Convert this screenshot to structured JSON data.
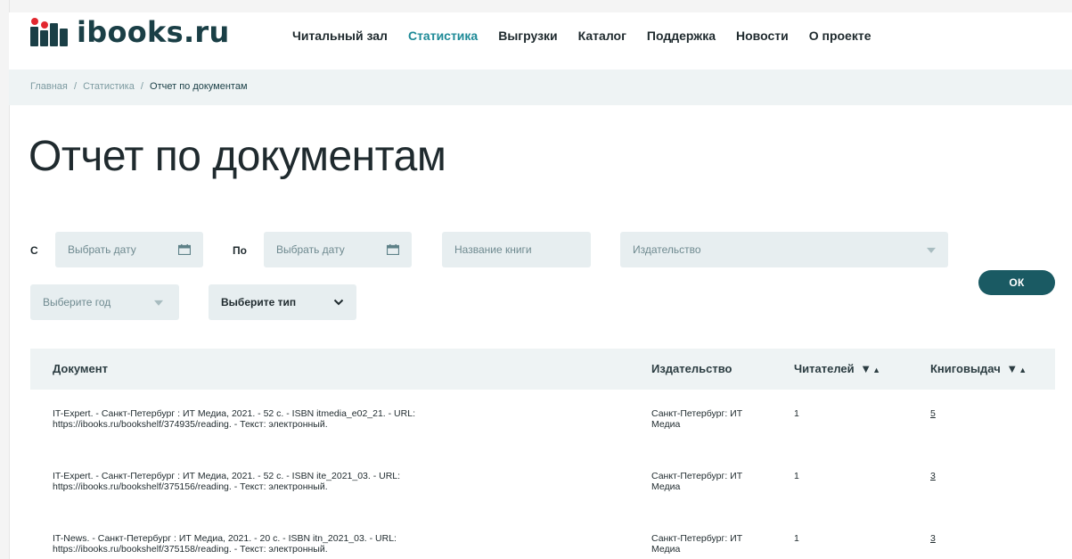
{
  "header": {
    "logo_text": "ibooks.ru",
    "nav": [
      {
        "label": "Читальный зал",
        "active": false
      },
      {
        "label": "Статистика",
        "active": true
      },
      {
        "label": "Выгрузки",
        "active": false
      },
      {
        "label": "Каталог",
        "active": false
      },
      {
        "label": "Поддержка",
        "active": false
      },
      {
        "label": "Новости",
        "active": false
      },
      {
        "label": "О проекте",
        "active": false
      }
    ]
  },
  "breadcrumb": {
    "home": "Главная",
    "section": "Статистика",
    "current": "Отчет по документам",
    "separator": "/"
  },
  "page_title": "Отчет по документам",
  "filters": {
    "from_label": "С",
    "from_placeholder": "Выбрать дату",
    "to_label": "По",
    "to_placeholder": "Выбрать дату",
    "book_placeholder": "Название книги",
    "publisher_placeholder": "Издательство",
    "year_placeholder": "Выберите год",
    "type_value": "Выберите тип",
    "ok_label": "ОК"
  },
  "table": {
    "headers": {
      "document": "Документ",
      "publisher": "Издательство",
      "readers": "Читателей",
      "loans": "Книговыдач"
    },
    "sort_down": "▼",
    "sort_up": "▲",
    "rows": [
      {
        "document_line1": "IT-Expert. - Санкт-Петербург : ИТ Медиа, 2021. - 52 с. - ISBN itmedia_e02_21. - URL:",
        "document_line2": "https://ibooks.ru/bookshelf/374935/reading. - Текст: электронный.",
        "publisher_line1": "Санкт-Петербург: ИТ",
        "publisher_line2": "Медиа",
        "readers": "1",
        "loans": "5"
      },
      {
        "document_line1": "IT-Expert. - Санкт-Петербург : ИТ Медиа, 2021. - 52 с. - ISBN ite_2021_03. - URL:",
        "document_line2": "https://ibooks.ru/bookshelf/375156/reading. - Текст: электронный.",
        "publisher_line1": "Санкт-Петербург: ИТ",
        "publisher_line2": "Медиа",
        "readers": "1",
        "loans": "3"
      },
      {
        "document_line1": "IT-News. - Санкт-Петербург : ИТ Медиа, 2021. - 20 с. - ISBN itn_2021_03. - URL:",
        "document_line2": "https://ibooks.ru/bookshelf/375158/reading. - Текст: электронный.",
        "publisher_line1": "Санкт-Петербург: ИТ",
        "publisher_line2": "Медиа",
        "readers": "1",
        "loans": "3"
      }
    ]
  },
  "icons": {
    "calendar": "calendar-icon",
    "dropdown_caret": "caret-down-icon",
    "select_chevron": "chevron-down-icon"
  },
  "colors": {
    "brand_dark": "#1a3f46",
    "logo_dot": "#e2272f",
    "nav_active": "#1e8a97",
    "field_bg": "#e7eef0",
    "ok_button": "#1a5a63",
    "breadcrumb_bg": "#eef3f4"
  }
}
